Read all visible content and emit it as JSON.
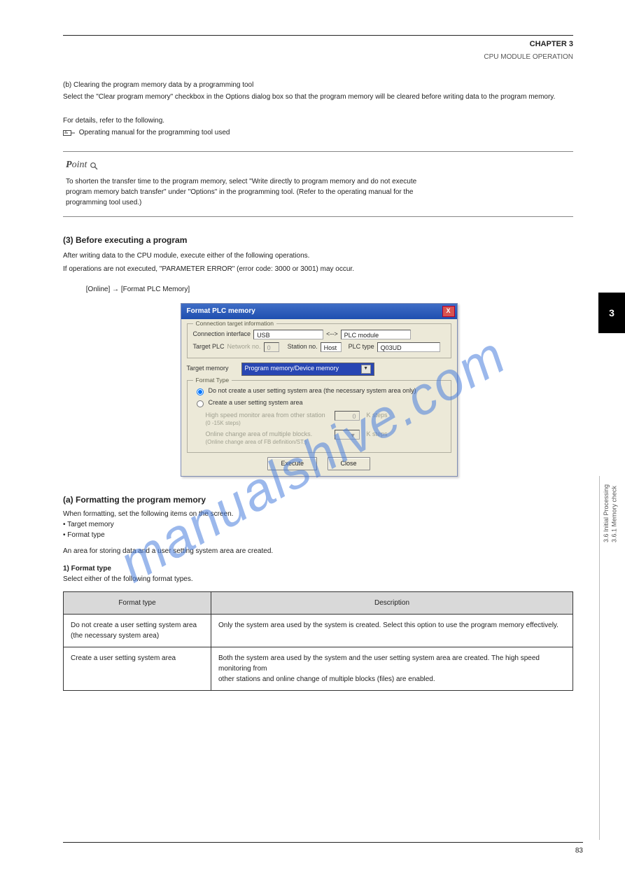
{
  "watermark": "manualshive.com",
  "header": {
    "chapter": "CHAPTER 3",
    "title": "CPU MODULE OPERATION"
  },
  "side_tab": {
    "num": "3"
  },
  "body": {
    "b2": "(b) Clearing the program memory data by a programming tool",
    "b2_desc": "Select the \"Clear program memory\" checkbox in the Options dialog box so that the program memory will be cleared before writing data to the program memory.",
    "note_a": "For details, refer to the following.",
    "ref": " Operating manual for the programming tool used"
  },
  "point": {
    "label_rest": "oint",
    "line1": "To shorten the transfer time to the program memory, select \"Write directly to program memory and do not execute",
    "line2": "program memory batch transfer\" under \"Options\" in the programming tool. (Refer to the operating manual for the",
    "line3": "programming tool used.)"
  },
  "fmt": {
    "heading": "(3) Before executing a program",
    "desc1": "After writing data to the CPU module, execute either of the following operations.",
    "desc2": "If operations are not executed, \"PARAMETER ERROR\" (error code: 3000 or 3001) may occur.",
    "menu1": "[Online]",
    "arrow": " → ",
    "menu2": "[Format PLC Memory]"
  },
  "dlg": {
    "title": "Format PLC memory",
    "close_x": "X",
    "conn": {
      "legend": "Connection target information",
      "iface_lbl": "Connection interface",
      "iface_val": "USB",
      "arrow": "<-->",
      "side_val": "PLC module",
      "target_lbl": "Target PLC",
      "net_lbl": "Network no.",
      "net_val": "0",
      "stn_lbl": "Station no.",
      "stn_val": "Host",
      "plct_lbl": "PLC type",
      "plct_val": "Q03UD"
    },
    "tmem": {
      "lbl": "Target memory",
      "val": "Program memory/Device memory"
    },
    "ftype": {
      "legend": "Format Type",
      "opt1": "Do not create a user setting system area (the necessary system area only)",
      "opt2": "Create a user setting system area",
      "hs_lbl": "High speed monitor area from other station",
      "hs_val": "0",
      "hs_unit": "K steps",
      "hs_range": "(0 -15K steps)",
      "oc_lbl": "Online change area of multiple blocks.",
      "oc_unit": "K steps",
      "oc_note": "(Online change area of FB definition/ST.)"
    },
    "btn_execute": "Execute",
    "btn_close": "Close"
  },
  "fsec": {
    "heading": "(a) Formatting the program memory",
    "d1": "When formatting, set the following items on the screen.",
    "b1": " • Target memory",
    "b2": " • Format type",
    "d2": "An area for storing data and a user setting system area are created.",
    "one": "1) Format type",
    "one_d": "Select either of the following format types."
  },
  "tbl": {
    "h1": "Format type",
    "h2": "Description",
    "r1c1a": "Do not create a user setting system area",
    "r1c1b": "(the necessary system area)",
    "r1c2": "Only the system area used by the system is created. Select this option to use the program memory effectively.",
    "r2c1": "Create a user setting system area",
    "r2c2a": "Both the system area used by the system and the user setting system area are created. The high speed monitoring from",
    "r2c2b": "other stations and online change of multiple blocks (files) are enabled."
  },
  "sidecap": {
    "l1": "3.6 Initial Processing",
    "l2": "3.6.1 Memory check"
  },
  "footer": {
    "page": "83"
  }
}
